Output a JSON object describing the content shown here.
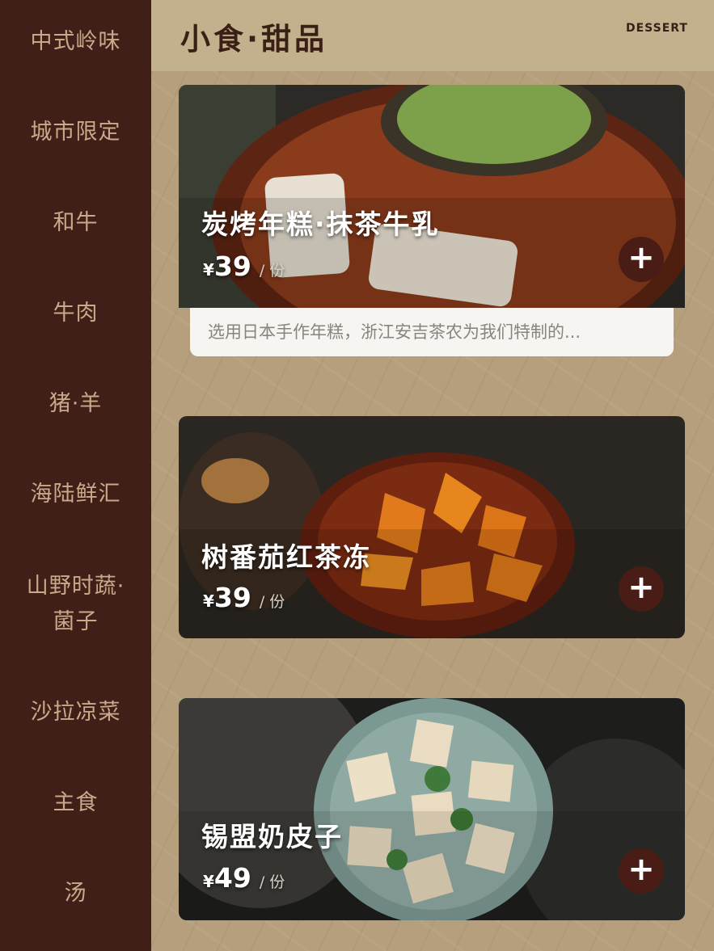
{
  "sidebar": {
    "items": [
      {
        "label": "中式岭味"
      },
      {
        "label": "城市限定"
      },
      {
        "label": "和牛"
      },
      {
        "label": "牛肉"
      },
      {
        "label": "猪·羊"
      },
      {
        "label": "海陆鲜汇"
      },
      {
        "label": "山野时蔬·",
        "label2": "菌子"
      },
      {
        "label": "沙拉凉菜"
      },
      {
        "label": "主食"
      },
      {
        "label": "汤"
      }
    ]
  },
  "header": {
    "title": "小食·甜品",
    "subtitle": "DESSERT"
  },
  "dishes": [
    {
      "name": "炭烤年糕·抹茶牛乳",
      "currency": "¥",
      "price": "39",
      "unit": "/ 份",
      "add": "+",
      "description": "选用日本手作年糕，浙江安吉茶农为我们特制的..."
    },
    {
      "name": "树番茄红茶冻",
      "currency": "¥",
      "price": "39",
      "unit": "/ 份",
      "add": "+"
    },
    {
      "name": "锡盟奶皮子",
      "currency": "¥",
      "price": "49",
      "unit": "/ 份",
      "add": "+"
    }
  ],
  "colors": {
    "sidebar_bg": "#3f1f17",
    "sidebar_text": "#c8a98a",
    "paper_bg": "#b59f7c",
    "accent_button": "#4a1c16"
  },
  "icons": {
    "add": "plus-icon"
  }
}
